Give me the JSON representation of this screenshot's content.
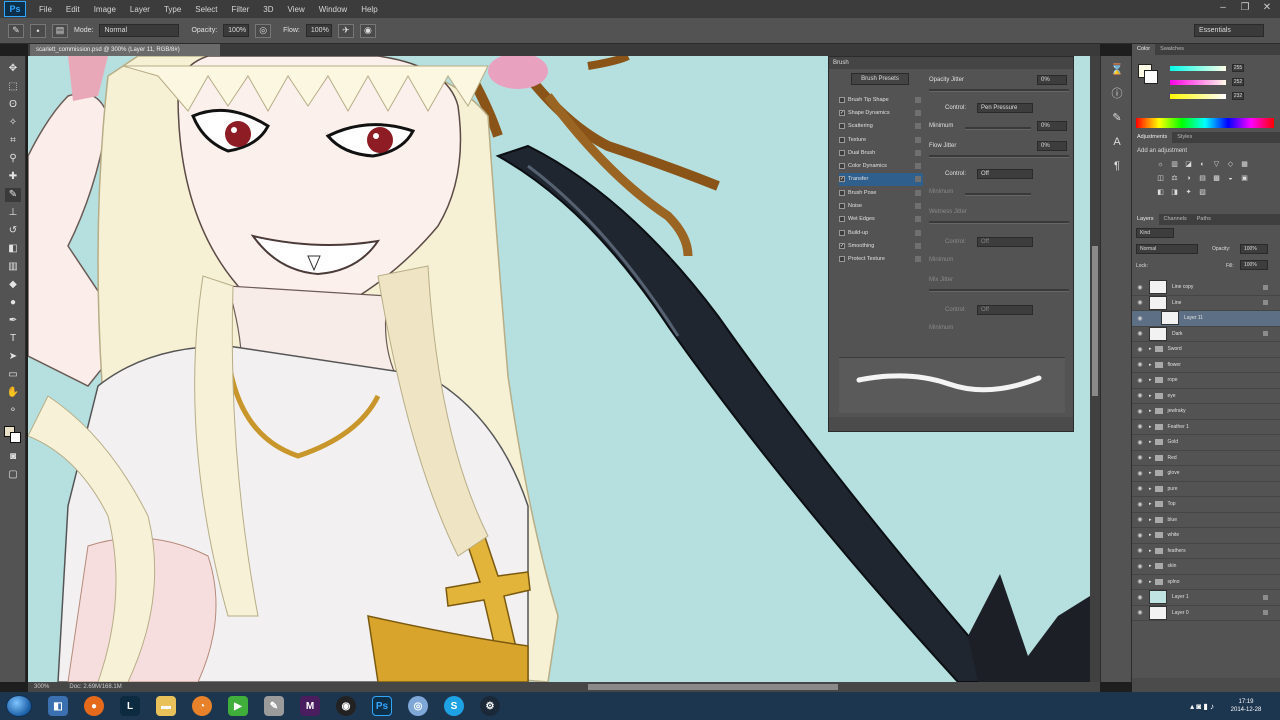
{
  "menu": [
    "File",
    "Edit",
    "Image",
    "Layer",
    "Type",
    "Select",
    "Filter",
    "3D",
    "View",
    "Window",
    "Help"
  ],
  "options_bar": {
    "mode_label": "Mode:",
    "mode_value": "Normal",
    "opacity_label": "Opacity:",
    "opacity_value": "100%",
    "flow_label": "Flow:",
    "flow_value": "100%",
    "workspace": "Essentials"
  },
  "document_tab": "scarlett_commission.psd @ 300% (Layer 11, RGB/8#)",
  "status_bar": {
    "zoom": "300%",
    "doc": "Doc: 2.69M/168.1M"
  },
  "brush_panel": {
    "title": "Brush",
    "presets_button": "Brush Presets",
    "items": [
      {
        "label": "Brush Tip Shape",
        "checked": false
      },
      {
        "label": "Shape Dynamics",
        "checked": true
      },
      {
        "label": "Scattering",
        "checked": false
      },
      {
        "label": "Texture",
        "checked": false
      },
      {
        "label": "Dual Brush",
        "checked": false
      },
      {
        "label": "Color Dynamics",
        "checked": false
      },
      {
        "label": "Transfer",
        "checked": true
      },
      {
        "label": "Brush Pose",
        "checked": false
      },
      {
        "label": "Noise",
        "checked": false
      },
      {
        "label": "Wet Edges",
        "checked": false
      },
      {
        "label": "Build-up",
        "checked": false
      },
      {
        "label": "Smoothing",
        "checked": true
      },
      {
        "label": "Protect Texture",
        "checked": false
      }
    ],
    "settings": {
      "opacity_jitter_label": "Opacity Jitter",
      "opacity_jitter_value": "0%",
      "control_label": "Control:",
      "control_value": "Pen Pressure",
      "minimum_label": "Minimum",
      "minimum_value": "0%",
      "flow_jitter_label": "Flow Jitter",
      "flow_jitter_value": "0%",
      "control2_value": "Off",
      "minimum2_label": "Minimum",
      "wetness_jitter_label": "Wetness Jitter",
      "control3_value": "Off",
      "mix_jitter_label": "Mix Jitter",
      "control4_value": "Off"
    }
  },
  "color_panel": {
    "tabs": [
      "Color",
      "Swatches"
    ],
    "values": [
      "255",
      "252",
      "232"
    ]
  },
  "adjustments_panel": {
    "tabs": [
      "Adjustments",
      "Styles"
    ],
    "title": "Add an adjustment"
  },
  "layers_panel": {
    "tabs": [
      "Layers",
      "Channels",
      "Paths"
    ],
    "kind": "Kind",
    "blend_mode": "Normal",
    "opacity_label": "Opacity:",
    "opacity_value": "100%",
    "lock_label": "Lock:",
    "fill_label": "Fill:",
    "fill_value": "100%",
    "layers": [
      {
        "name": "Line copy",
        "type": "layer",
        "selected": false
      },
      {
        "name": "Line",
        "type": "layer",
        "selected": false
      },
      {
        "name": "Layer 11",
        "type": "layer",
        "selected": true
      },
      {
        "name": "Dark",
        "type": "layer",
        "selected": false
      },
      {
        "name": "Sword",
        "type": "folder",
        "selected": false
      },
      {
        "name": "flower",
        "type": "folder",
        "selected": false
      },
      {
        "name": "rope",
        "type": "folder",
        "selected": false
      },
      {
        "name": "eye",
        "type": "folder",
        "selected": false
      },
      {
        "name": "jewlraky",
        "type": "folder",
        "selected": false
      },
      {
        "name": "Feather 1",
        "type": "folder",
        "selected": false
      },
      {
        "name": "Gold",
        "type": "folder",
        "selected": false
      },
      {
        "name": "Red",
        "type": "folder",
        "selected": false
      },
      {
        "name": "glove",
        "type": "folder",
        "selected": false
      },
      {
        "name": "pure",
        "type": "folder",
        "selected": false
      },
      {
        "name": "Top",
        "type": "folder",
        "selected": false
      },
      {
        "name": "blue",
        "type": "folder",
        "selected": false
      },
      {
        "name": "white",
        "type": "folder",
        "selected": false
      },
      {
        "name": "feathers",
        "type": "folder",
        "selected": false
      },
      {
        "name": "skin",
        "type": "folder",
        "selected": false
      },
      {
        "name": "splno",
        "type": "folder",
        "selected": false
      },
      {
        "name": "Layer 1",
        "type": "layer-teal",
        "selected": false
      },
      {
        "name": "Layer 0",
        "type": "layer",
        "selected": false
      }
    ]
  },
  "taskbar": {
    "time": "17:19",
    "date": "2014-12-28"
  },
  "colors": {
    "canvas_bg": "#b6e0df",
    "panel_bg": "#535353",
    "selection": "#2f5f8c",
    "taskbar": "#1d3650"
  }
}
